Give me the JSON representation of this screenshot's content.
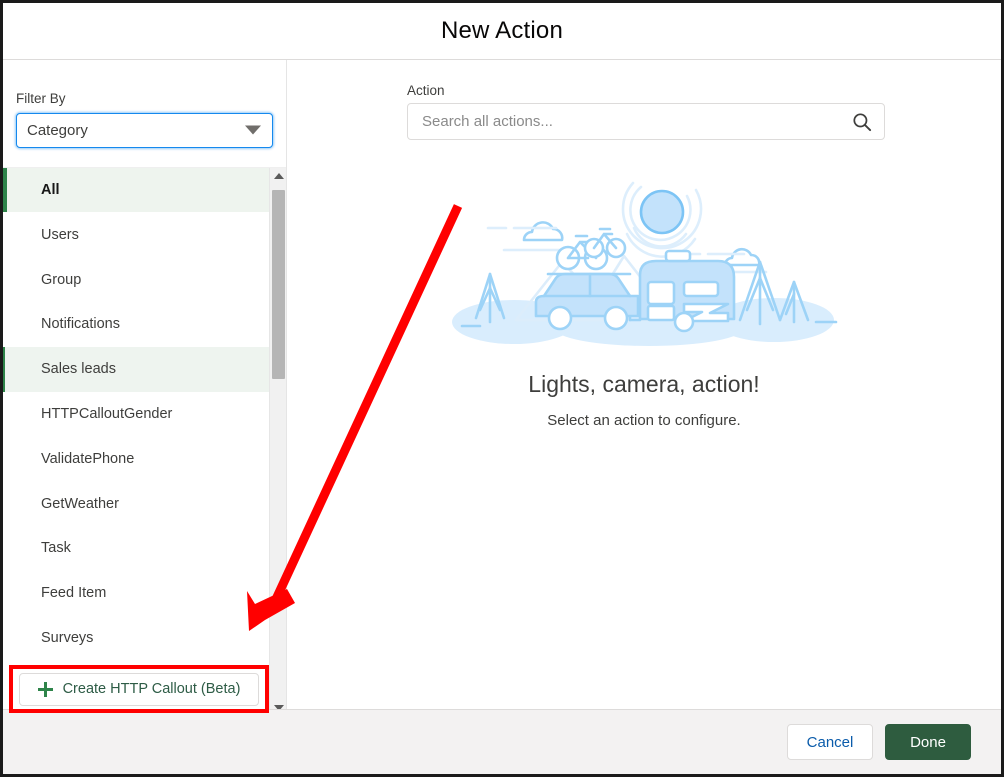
{
  "header": {
    "title": "New Action"
  },
  "sidebar": {
    "filter_label": "Filter By",
    "filter_value": "Category",
    "filter_icon": "chevron-down-icon",
    "categories": [
      {
        "label": "All",
        "state": "selected"
      },
      {
        "label": "Users",
        "state": "default"
      },
      {
        "label": "Group",
        "state": "default"
      },
      {
        "label": "Notifications",
        "state": "default"
      },
      {
        "label": "Sales leads",
        "state": "hovered"
      },
      {
        "label": "HTTPCalloutGender",
        "state": "default"
      },
      {
        "label": "ValidatePhone",
        "state": "default"
      },
      {
        "label": "GetWeather",
        "state": "default"
      },
      {
        "label": "Task",
        "state": "default"
      },
      {
        "label": "Feed Item",
        "state": "default"
      },
      {
        "label": "Surveys",
        "state": "default"
      }
    ],
    "create_callout_label": "Create HTTP Callout (Beta)",
    "create_callout_icon": "plus-icon",
    "scrollbar": {
      "up_icon": "triangle-up-icon",
      "down_icon": "triangle-down-icon"
    }
  },
  "main": {
    "action_label": "Action",
    "search_placeholder": "Search all actions...",
    "search_value": "",
    "search_icon": "search-icon",
    "empty_state": {
      "illustration": "camping-road-trip-illustration",
      "title": "Lights, camera, action!",
      "subtitle": "Select an action to configure."
    }
  },
  "footer": {
    "cancel_label": "Cancel",
    "done_label": "Done"
  },
  "annotation": {
    "arrow_color": "#ff0000",
    "highlight_color": "#ff0000",
    "target": "Create HTTP Callout (Beta)"
  },
  "colors": {
    "accent_green": "#2e844a",
    "done_green": "#2e5c3f",
    "focus_blue": "#1589ee",
    "link_blue": "#0b5cab",
    "illustration_blue": "#c3e2fb",
    "annotation_red": "#ff0000"
  }
}
